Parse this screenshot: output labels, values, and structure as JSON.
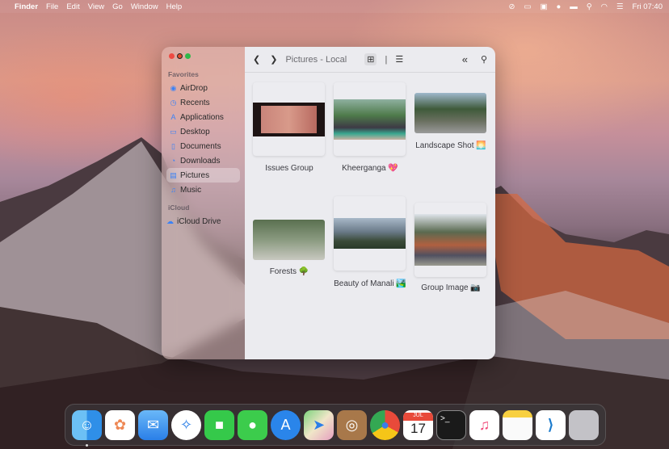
{
  "menubar": {
    "app": "Finder",
    "items": [
      "File",
      "Edit",
      "View",
      "Go",
      "Window",
      "Help"
    ],
    "clock": "Fri 07:40"
  },
  "window": {
    "title": "Pictures - Local"
  },
  "sidebar": {
    "favorites_label": "Favorites",
    "favorites": [
      {
        "label": "AirDrop",
        "icon": "airdrop-icon"
      },
      {
        "label": "Recents",
        "icon": "clock-icon"
      },
      {
        "label": "Applications",
        "icon": "applications-icon"
      },
      {
        "label": "Desktop",
        "icon": "desktop-icon"
      },
      {
        "label": "Documents",
        "icon": "document-icon"
      },
      {
        "label": "Downloads",
        "icon": "download-icon"
      },
      {
        "label": "Pictures",
        "icon": "pictures-icon",
        "selected": true
      },
      {
        "label": "Music",
        "icon": "music-icon"
      }
    ],
    "icloud_label": "iCloud",
    "icloud": [
      {
        "label": "iCloud Drive",
        "icon": "cloud-icon"
      }
    ]
  },
  "files": [
    {
      "name": "Issues Group"
    },
    {
      "name": "Kheerganga 💖"
    },
    {
      "name": "Landscape Shot 🌅"
    },
    {
      "name": "Forests 🌳"
    },
    {
      "name": "Beauty of Manali 🏞️"
    },
    {
      "name": "Group Image 📷"
    }
  ],
  "dock": {
    "calendar_month": "JUL",
    "calendar_day": "17",
    "apps": [
      "Finder",
      "Photos",
      "Mail",
      "Safari",
      "FaceTime",
      "Messages",
      "App Store",
      "Maps",
      "Contacts",
      "Chrome",
      "Calendar",
      "Terminal",
      "iTunes",
      "Notes",
      "VS Code",
      "Trash"
    ]
  }
}
